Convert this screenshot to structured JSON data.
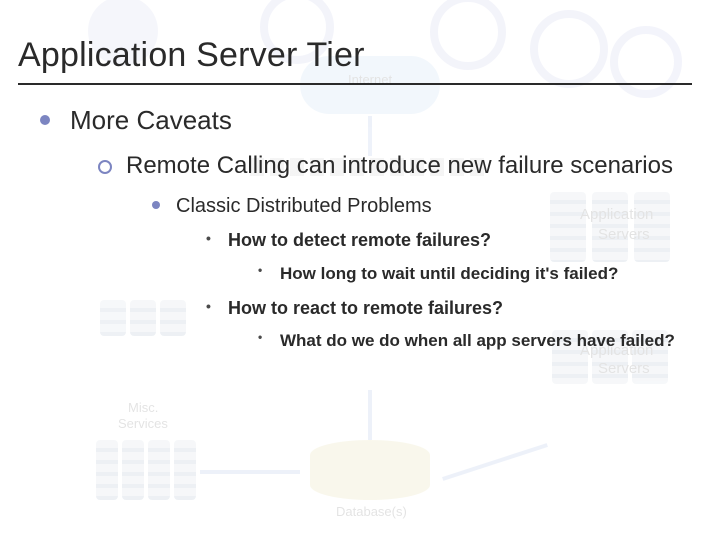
{
  "title": "Application Server Tier",
  "bullets": {
    "l1": "More Caveats",
    "l2": "Remote Calling can introduce new failure scenarios",
    "l3": "Classic Distributed Problems",
    "l4a": "How to detect remote failures?",
    "l5a": "How long to wait until deciding it's failed?",
    "l4b": "How to react to remote failures?",
    "l5b": "What do we do when all app servers have failed?"
  },
  "bg": {
    "cloud_label": "Internet",
    "app_label_1": "Application",
    "app_label_2": "Servers",
    "misc_label_1": "Misc.",
    "misc_label_2": "Services",
    "db_label": "Database(s)"
  }
}
